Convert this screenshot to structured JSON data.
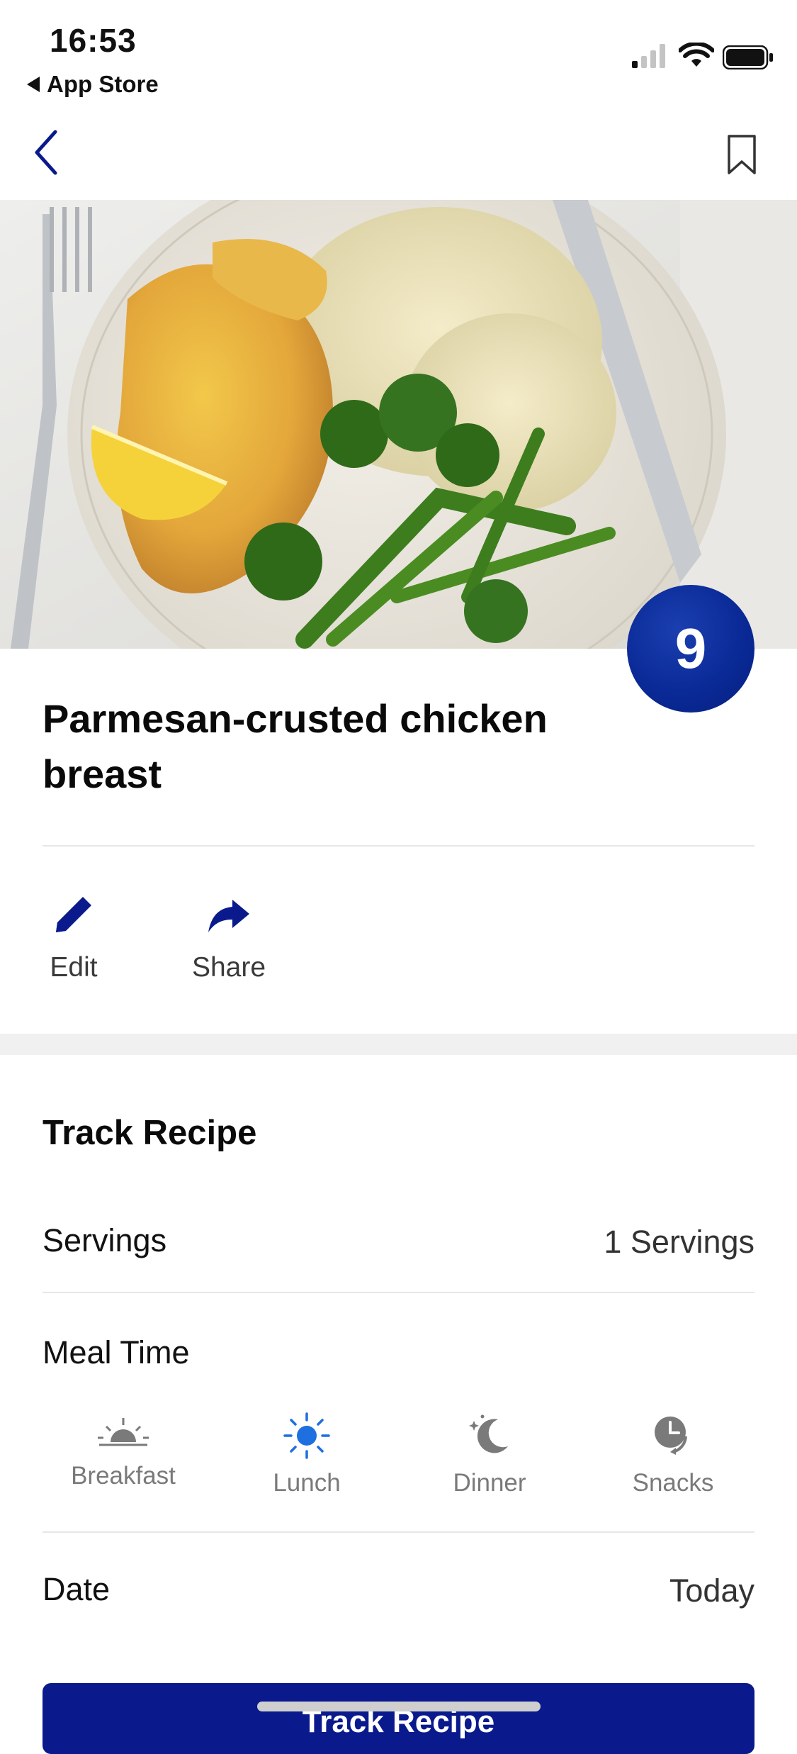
{
  "status_bar": {
    "time": "16:53",
    "back_app": "App Store"
  },
  "icons": {
    "back": "chevron-left-icon",
    "bookmark": "bookmark-icon",
    "edit": "pencil-icon",
    "share": "share-arrow-icon",
    "breakfast": "sunrise-icon",
    "lunch": "sun-icon",
    "dinner": "moon-icon",
    "snacks": "clock-icon"
  },
  "colors": {
    "accent": "#0a1a8c",
    "badge": "#0a2a97",
    "selected_meal": "#1e6fe0",
    "unselected_meal": "#7a7a7a"
  },
  "recipe": {
    "score": "9",
    "title": "Parmesan-crusted chicken breast"
  },
  "actions": {
    "edit_label": "Edit",
    "share_label": "Share"
  },
  "track": {
    "section_title": "Track Recipe",
    "servings_label": "Servings",
    "servings_value": "1 Servings",
    "meal_time_label": "Meal Time",
    "meals": [
      {
        "label": "Breakfast",
        "selected": false
      },
      {
        "label": "Lunch",
        "selected": true
      },
      {
        "label": "Dinner",
        "selected": false
      },
      {
        "label": "Snacks",
        "selected": false
      }
    ],
    "date_label": "Date",
    "date_value": "Today",
    "cta_label": "Track Recipe"
  }
}
